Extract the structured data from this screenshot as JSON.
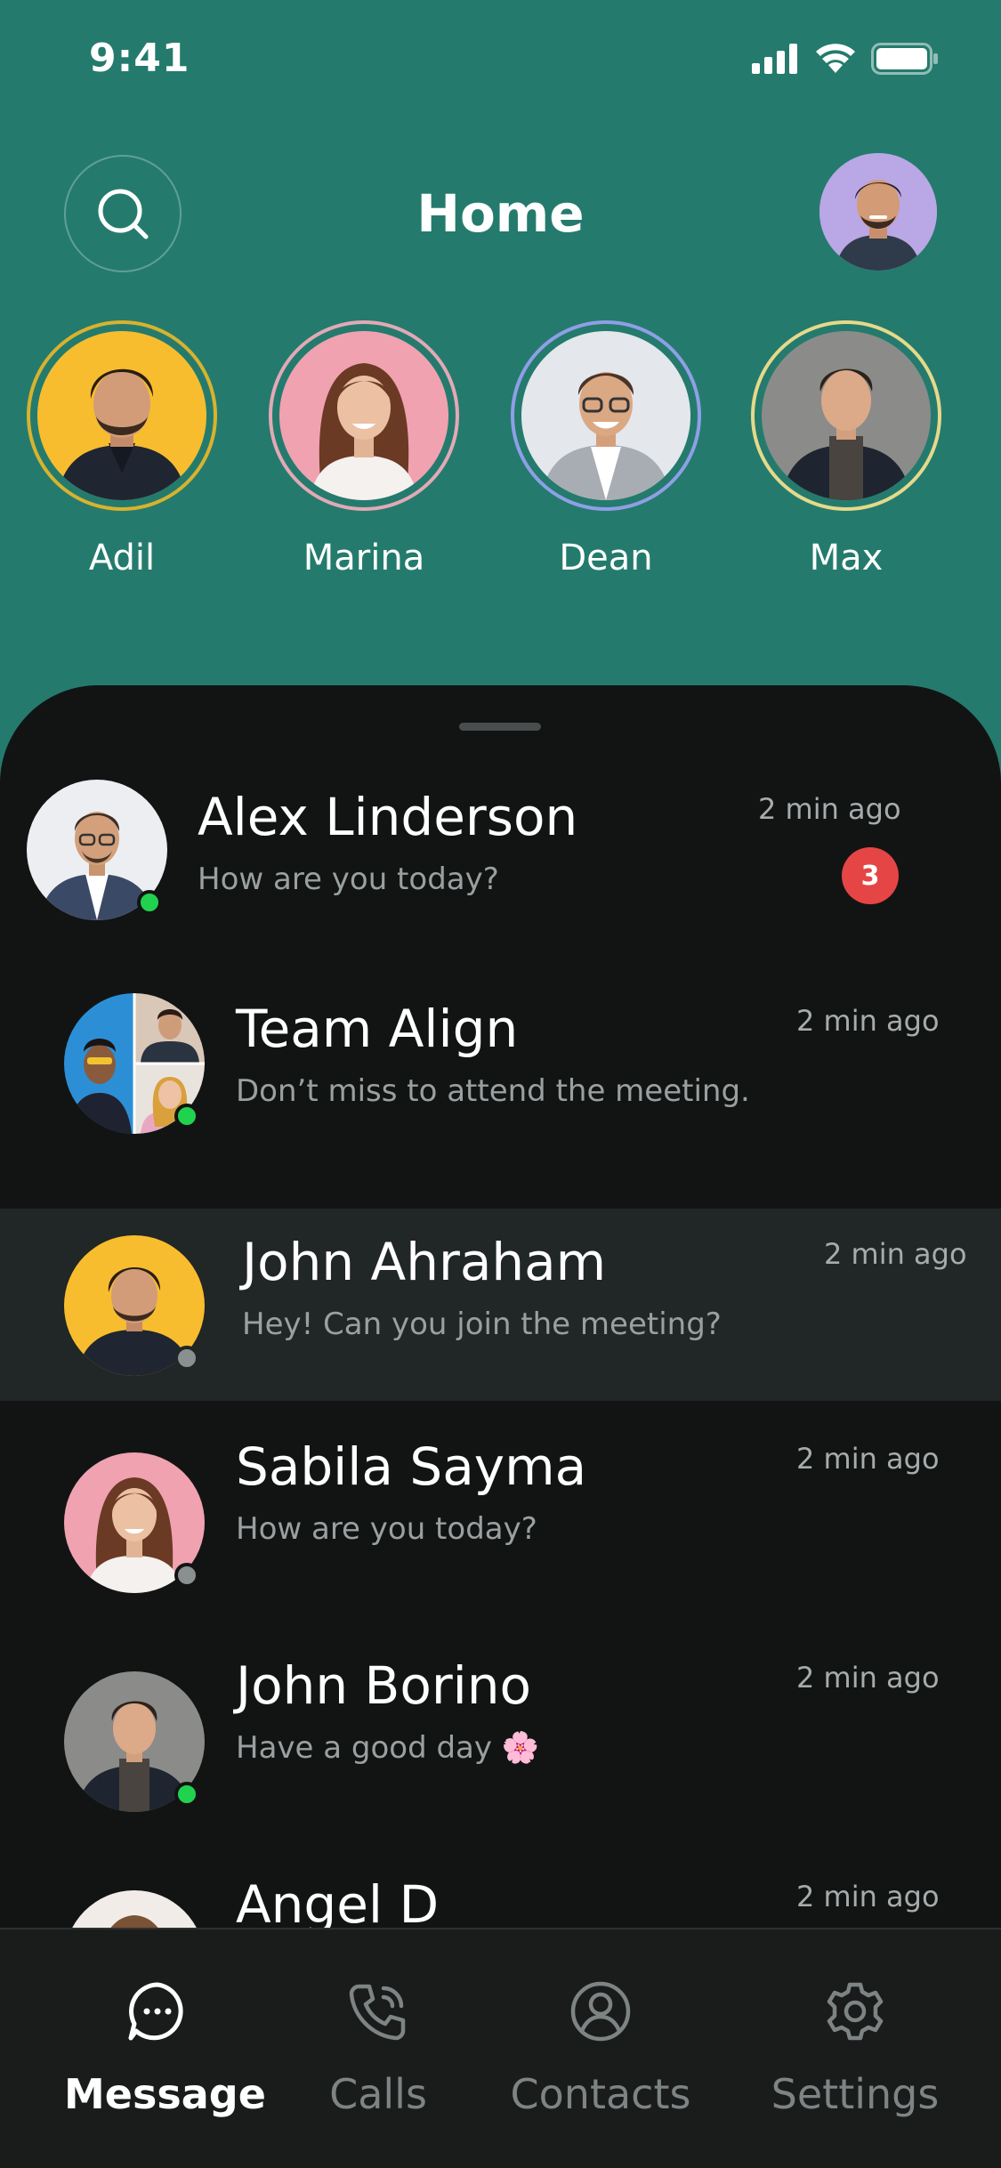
{
  "status_bar": {
    "time": "9:41"
  },
  "header": {
    "title": "Home"
  },
  "stories": [
    {
      "name": "Adil",
      "ring_color": "#d9b22e",
      "bg": "#f7bd2e"
    },
    {
      "name": "Marina",
      "ring_color": "#e3a9b6",
      "bg": "#f0a2b1"
    },
    {
      "name": "Dean",
      "ring_color": "#8f9fe6",
      "bg": "#e4e7ec"
    },
    {
      "name": "Max",
      "ring_color": "#e6d98a",
      "bg": "#8b8b8a"
    }
  ],
  "chats": [
    {
      "name": "Alex Linderson",
      "message": "How are you today?",
      "time": "2 min ago",
      "unread": "3",
      "presence": "online"
    },
    {
      "name": "Team Align",
      "message": "Don’t miss to attend the meeting.",
      "time": "2 min ago",
      "presence": "online"
    },
    {
      "name": "John Ahraham",
      "message": "Hey! Can you join the meeting?",
      "time": "2 min ago",
      "presence": "offline"
    },
    {
      "name": "Sabila Sayma",
      "message": "How are you today?",
      "time": "2 min ago",
      "presence": "offline"
    },
    {
      "name": "John Borino",
      "message": "Have a good day 🌸",
      "time": "2 min ago",
      "presence": "online"
    },
    {
      "name": "Angel D",
      "message": "",
      "time": "2 min ago",
      "presence": "online"
    }
  ],
  "tabs": [
    {
      "label": "Message",
      "icon": "message-icon",
      "active": true
    },
    {
      "label": "Calls",
      "icon": "phone-icon",
      "active": false
    },
    {
      "label": "Contacts",
      "icon": "user-icon",
      "active": false
    },
    {
      "label": "Settings",
      "icon": "gear-icon",
      "active": false
    }
  ],
  "colors": {
    "header_bg": "#247b6d",
    "sheet_bg": "#121414",
    "online": "#21d24f",
    "offline": "#8a8f8f",
    "badge": "#e64545"
  }
}
